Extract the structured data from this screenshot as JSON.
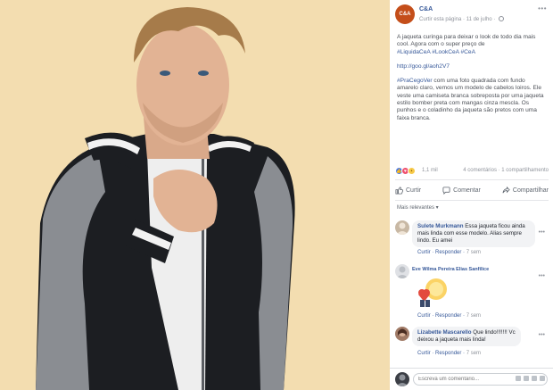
{
  "post": {
    "page_name": "C&A",
    "logo_text": "C&A",
    "follow_label": "Curtir esta página",
    "date": "11 de julho",
    "more": "•••",
    "paragraph1_text": "A jaqueta curinga para deixar o look de todo dia mais cool. Agora com o super preço de",
    "paragraph1_tags": "#LiquidaCeA #LookCeA #CeA",
    "link": "http://goo.gl/aoh2V7",
    "paragraph2_tag": "#PraCegoVer",
    "paragraph2_text": " com uma foto quadrada com fundo amarelo claro, vemos um modelo de cabelos loiros. Ele veste uma camiseta branca sobreposta por uma jaqueta estilo bomber preta com mangas cinza mescla. Os punhos e o coladinho da jaqueta são pretos com uma faixa branca."
  },
  "reactions": {
    "icons": [
      "like",
      "love",
      "wow"
    ],
    "count": "1,1 mil",
    "comments": "4 comentários",
    "shares": "1 compartilhamento"
  },
  "actions": {
    "like": "Curtir",
    "comment": "Comentar",
    "share": "Compartilhar"
  },
  "filter_label": "Mais relevantes ▾",
  "comments": [
    {
      "name": "Sulete Murkmann",
      "text_line1": " Essa jaqueta ficou",
      "text_rest": "ainda mais linda com esse modelo. Alias sempre lindo. Eu amei",
      "like": "Curtir",
      "reply": "Responder",
      "time": "7 sem",
      "more": "•••"
    },
    {
      "name": "Eve Wilma Pereira Elias Sanfilice",
      "text_line1": "",
      "text_rest": "",
      "like": "Curtir",
      "reply": "Responder",
      "time": "7 sem",
      "more": "•••"
    },
    {
      "name": "Lizabette Mascarello",
      "text_line1": " Que lindo!!!!!!!",
      "text_rest": "Vc deixou a jaqueta mais linda!",
      "like": "Curtir",
      "reply": "Responder",
      "time": "7 sem",
      "more": "•••"
    }
  ],
  "reply_placeholder": "Escreva um comentário..."
}
